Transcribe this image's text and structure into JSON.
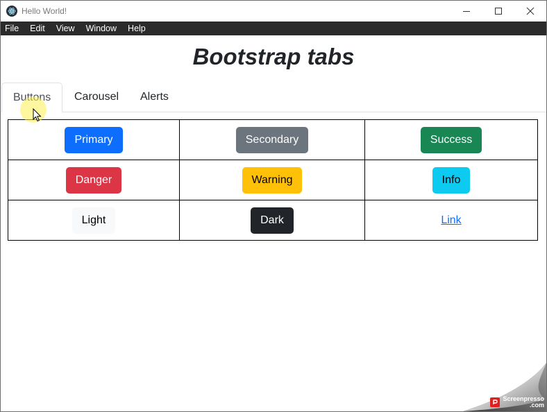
{
  "window": {
    "title": "Hello World!"
  },
  "menu": {
    "items": [
      "File",
      "Edit",
      "View",
      "Window",
      "Help"
    ]
  },
  "page": {
    "title": "Bootstrap tabs"
  },
  "tabs": [
    {
      "label": "Buttons",
      "active": true
    },
    {
      "label": "Carousel",
      "active": false
    },
    {
      "label": "Alerts",
      "active": false
    }
  ],
  "buttons": {
    "rows": [
      [
        "Primary",
        "Secondary",
        "Success"
      ],
      [
        "Danger",
        "Warning",
        "Info"
      ],
      [
        "Light",
        "Dark",
        "Link"
      ]
    ]
  },
  "colors": {
    "primary": "#0d6efd",
    "secondary": "#6c757d",
    "success": "#198754",
    "danger": "#dc3545",
    "warning": "#ffc107",
    "info": "#0dcaf0",
    "light": "#f8f9fa",
    "dark": "#212529"
  },
  "watermark": {
    "line1": "Screenpresso",
    "line2": ".com"
  }
}
